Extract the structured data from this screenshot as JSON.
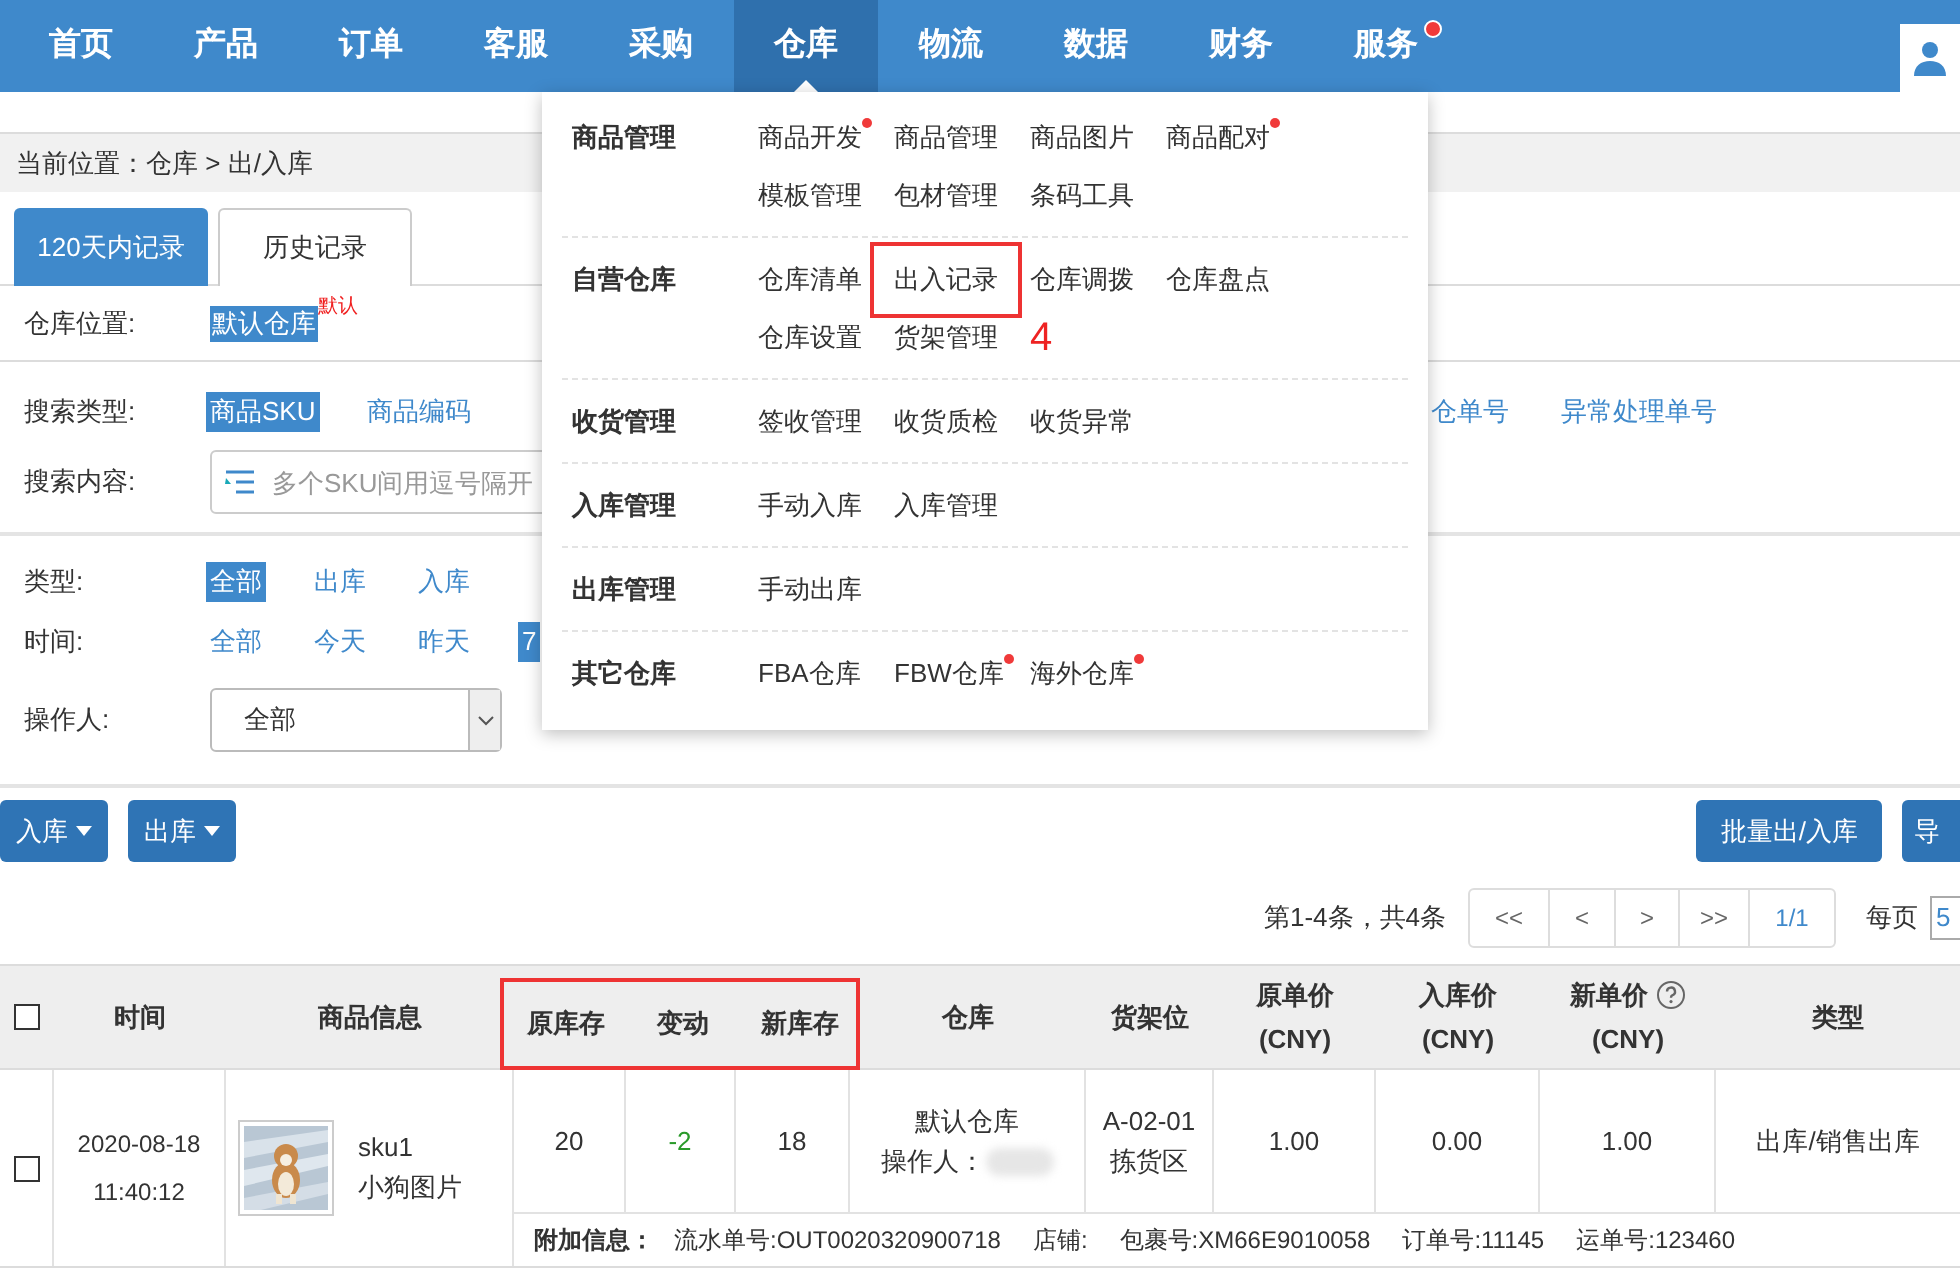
{
  "nav": {
    "items": [
      {
        "label": "首页",
        "selected": false,
        "dot": false
      },
      {
        "label": "产品",
        "selected": false,
        "dot": false
      },
      {
        "label": "订单",
        "selected": false,
        "dot": false
      },
      {
        "label": "客服",
        "selected": false,
        "dot": false
      },
      {
        "label": "采购",
        "selected": false,
        "dot": false
      },
      {
        "label": "仓库",
        "selected": true,
        "dot": false
      },
      {
        "label": "物流",
        "selected": false,
        "dot": false
      },
      {
        "label": "数据",
        "selected": false,
        "dot": false
      },
      {
        "label": "财务",
        "selected": false,
        "dot": false
      },
      {
        "label": "服务",
        "selected": false,
        "dot": true
      }
    ]
  },
  "menu": {
    "sections": [
      {
        "label": "商品管理",
        "items": [
          {
            "label": "商品开发",
            "dot": true,
            "boxed": false
          },
          {
            "label": "商品管理",
            "dot": false,
            "boxed": false
          },
          {
            "label": "商品图片",
            "dot": false,
            "boxed": false
          },
          {
            "label": "商品配对",
            "dot": true,
            "boxed": false
          },
          {
            "label": "模板管理",
            "dot": false,
            "boxed": false
          },
          {
            "label": "包材管理",
            "dot": false,
            "boxed": false
          },
          {
            "label": "条码工具",
            "dot": false,
            "boxed": false
          }
        ]
      },
      {
        "label": "自营仓库",
        "items": [
          {
            "label": "仓库清单",
            "dot": false,
            "boxed": false
          },
          {
            "label": "出入记录",
            "dot": false,
            "boxed": true
          },
          {
            "label": "仓库调拨",
            "dot": false,
            "boxed": false
          },
          {
            "label": "仓库盘点",
            "dot": false,
            "boxed": false
          },
          {
            "label": "仓库设置",
            "dot": false,
            "boxed": false
          },
          {
            "label": "货架管理",
            "dot": false,
            "boxed": false
          }
        ],
        "annotation": "4"
      },
      {
        "label": "收货管理",
        "items": [
          {
            "label": "签收管理",
            "dot": false,
            "boxed": false
          },
          {
            "label": "收货质检",
            "dot": false,
            "boxed": false
          },
          {
            "label": "收货异常",
            "dot": false,
            "boxed": false
          }
        ]
      },
      {
        "label": "入库管理",
        "items": [
          {
            "label": "手动入库",
            "dot": false,
            "boxed": false
          },
          {
            "label": "入库管理",
            "dot": false,
            "boxed": false
          }
        ]
      },
      {
        "label": "出库管理",
        "items": [
          {
            "label": "手动出库",
            "dot": false,
            "boxed": false
          }
        ]
      },
      {
        "label": "其它仓库",
        "items": [
          {
            "label": "FBA仓库",
            "dot": false,
            "boxed": false
          },
          {
            "label": "FBW仓库",
            "dot": true,
            "boxed": false
          },
          {
            "label": "海外仓库",
            "dot": true,
            "boxed": false
          }
        ]
      }
    ]
  },
  "breadcrumb": "当前位置：仓库 > 出/入库",
  "tabs": [
    {
      "label": "120天内记录",
      "selected": true
    },
    {
      "label": "历史记录",
      "selected": false
    }
  ],
  "warehouse": {
    "label": "仓库位置:",
    "value": "默认仓库",
    "tag": "默认"
  },
  "search_type": {
    "label": "搜索类型:",
    "options": [
      {
        "label": "商品SKU",
        "selected": true
      },
      {
        "label": "商品编码",
        "selected": false
      },
      {
        "label": "仓单号",
        "selected": false
      },
      {
        "label": "异常处理单号",
        "selected": false
      }
    ]
  },
  "search_content": {
    "label": "搜索内容:",
    "placeholder": "多个SKU间用逗号隔开"
  },
  "type_filter": {
    "label": "类型:",
    "options": [
      {
        "label": "全部",
        "selected": true
      },
      {
        "label": "出库",
        "selected": false
      },
      {
        "label": "入库",
        "selected": false
      }
    ]
  },
  "time_filter": {
    "label": "时间:",
    "options": [
      {
        "label": "全部",
        "selected": false
      },
      {
        "label": "今天",
        "selected": false
      },
      {
        "label": "昨天",
        "selected": false
      },
      {
        "label": "7",
        "selected": true
      }
    ]
  },
  "operator": {
    "label": "操作人:",
    "value": "全部"
  },
  "actions_left": [
    {
      "label": "入库"
    },
    {
      "label": "出库"
    }
  ],
  "actions_right": [
    {
      "label": "批量出/入库"
    },
    {
      "label": "导"
    }
  ],
  "pagination": {
    "summary": "第1-4条，共4条",
    "buttons": [
      "<<",
      "<",
      ">",
      ">>"
    ],
    "page": "1/1",
    "per_page_label": "每页",
    "per_page": "5"
  },
  "table": {
    "columns": [
      {
        "kind": "checkbox",
        "checked": false,
        "boxed": false
      },
      {
        "label": "时间",
        "boxed": false
      },
      {
        "label": "商品信息",
        "boxed": false
      },
      {
        "label": "原库存",
        "boxed": true
      },
      {
        "label": "变动",
        "boxed": true
      },
      {
        "label": "新库存",
        "boxed": true
      },
      {
        "label": "仓库",
        "boxed": false
      },
      {
        "label": "货架位",
        "boxed": false
      },
      {
        "label": "原单价",
        "sub": "(CNY)",
        "boxed": false
      },
      {
        "label": "入库价",
        "sub": "(CNY)",
        "boxed": false
      },
      {
        "label": "新单价",
        "sub": "(CNY)",
        "help": true,
        "boxed": false
      },
      {
        "label": "类型",
        "boxed": false
      }
    ],
    "rows": [
      {
        "checked": false,
        "date": "2020-08-18",
        "time": "11:40:12",
        "sku": "sku1",
        "product": "小狗图片",
        "old_stock": "20",
        "change": {
          "text": "-2",
          "color": "#2a9a2a"
        },
        "new_stock": "18",
        "warehouse": "默认仓库",
        "operator_label": "操作人：",
        "shelf": "A-02-01",
        "zone": "拣货区",
        "old_price": "1.00",
        "in_price": "0.00",
        "new_price": "1.00",
        "type": "出库/销售出库",
        "extra_label": "附加信息：",
        "extra": [
          "流水单号:OUT0020320900718",
          "店铺:",
          "包裹号:XM66E9010058",
          "订单号:11145",
          "运单号:123460"
        ]
      }
    ]
  }
}
